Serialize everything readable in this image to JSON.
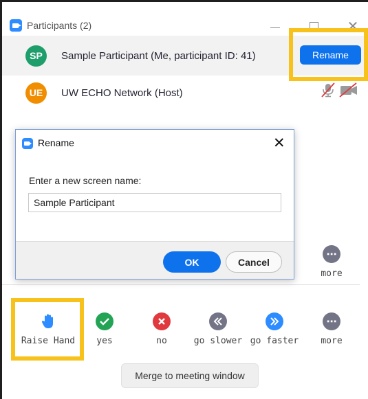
{
  "window": {
    "title": "Participants (2)",
    "minimize_glyph": "—",
    "close_glyph": "✕"
  },
  "participants": [
    {
      "initials": "SP",
      "avatar_color": "#1e9e6a",
      "name": "Sample Participant (Me, participant ID: 41)",
      "action_label": "Rename"
    },
    {
      "initials": "UE",
      "avatar_color": "#f08d00",
      "name": "UW ECHO Network (Host)",
      "icons": [
        "muted-microphone-icon",
        "video-off-icon"
      ]
    }
  ],
  "upper_more": {
    "label": "more",
    "icon": "more-icon"
  },
  "reactions": [
    {
      "label": "Raise Hand",
      "icon": "raised-hand-icon",
      "color": "#2d8cff"
    },
    {
      "label": "yes",
      "icon": "check-icon",
      "color": "#23a455"
    },
    {
      "label": "no",
      "icon": "x-icon",
      "color": "#e0393e"
    },
    {
      "label": "go slower",
      "icon": "rewind-icon",
      "color": "#747487"
    },
    {
      "label": "go faster",
      "icon": "fast-forward-icon",
      "color": "#2d8cff"
    },
    {
      "label": "more",
      "icon": "more-icon",
      "color": "#747487"
    }
  ],
  "merge_button": "Merge to meeting window",
  "dialog": {
    "title": "Rename",
    "close_glyph": "✕",
    "prompt": "Enter a new screen name:",
    "input_value": "Sample Participant",
    "ok_label": "OK",
    "cancel_label": "Cancel"
  },
  "colors": {
    "accent": "#0e72ed",
    "highlight": "#f7c21b"
  }
}
